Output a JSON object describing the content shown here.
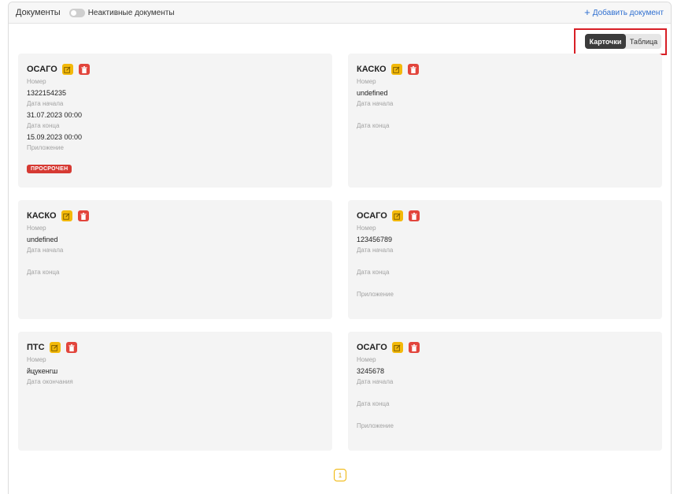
{
  "header": {
    "title": "Документы",
    "toggle_label": "Неактивные документы",
    "add_label": "Добавить документ"
  },
  "view_switch": {
    "cards_label": "Карточки",
    "table_label": "Таблица",
    "active": "cards"
  },
  "cards": [
    {
      "title": "ОСАГО",
      "fields": [
        {
          "label": "Номер",
          "value": "1322154235"
        },
        {
          "label": "Дата начала",
          "value": "31.07.2023 00:00"
        },
        {
          "label": "Дата конца",
          "value": "15.09.2023 00:00"
        },
        {
          "label": "Приложение",
          "value": ""
        }
      ],
      "badge": "ПРОСРОЧЕН"
    },
    {
      "title": "КАСКО",
      "fields": [
        {
          "label": "Номер",
          "value": "undefined"
        },
        {
          "label": "Дата начала",
          "value": ""
        },
        {
          "label": "Дата конца",
          "value": ""
        }
      ]
    },
    {
      "title": "КАСКО",
      "fields": [
        {
          "label": "Номер",
          "value": "undefined"
        },
        {
          "label": "Дата начала",
          "value": ""
        },
        {
          "label": "Дата конца",
          "value": ""
        }
      ]
    },
    {
      "title": "ОСАГО",
      "fields": [
        {
          "label": "Номер",
          "value": "123456789"
        },
        {
          "label": "Дата начала",
          "value": ""
        },
        {
          "label": "Дата конца",
          "value": ""
        },
        {
          "label": "Приложение",
          "value": ""
        }
      ]
    },
    {
      "title": "ПТС",
      "fields": [
        {
          "label": "Номер",
          "value": "йцукенгш"
        },
        {
          "label": "Дата окончания",
          "value": ""
        }
      ]
    },
    {
      "title": "ОСАГО",
      "fields": [
        {
          "label": "Номер",
          "value": "3245678"
        },
        {
          "label": "Дата начала",
          "value": ""
        },
        {
          "label": "Дата конца",
          "value": ""
        },
        {
          "label": "Приложение",
          "value": ""
        }
      ]
    }
  ],
  "pagination": {
    "current_page": "1"
  },
  "colors": {
    "edit": "#f3b90a",
    "delete": "#e2453c",
    "badge": "#d63a33",
    "highlight": "#d81f26",
    "link": "#2f6fd0"
  },
  "icons": {
    "edit": "pencil-square-icon",
    "delete": "trash-icon",
    "add": "plus-icon"
  }
}
